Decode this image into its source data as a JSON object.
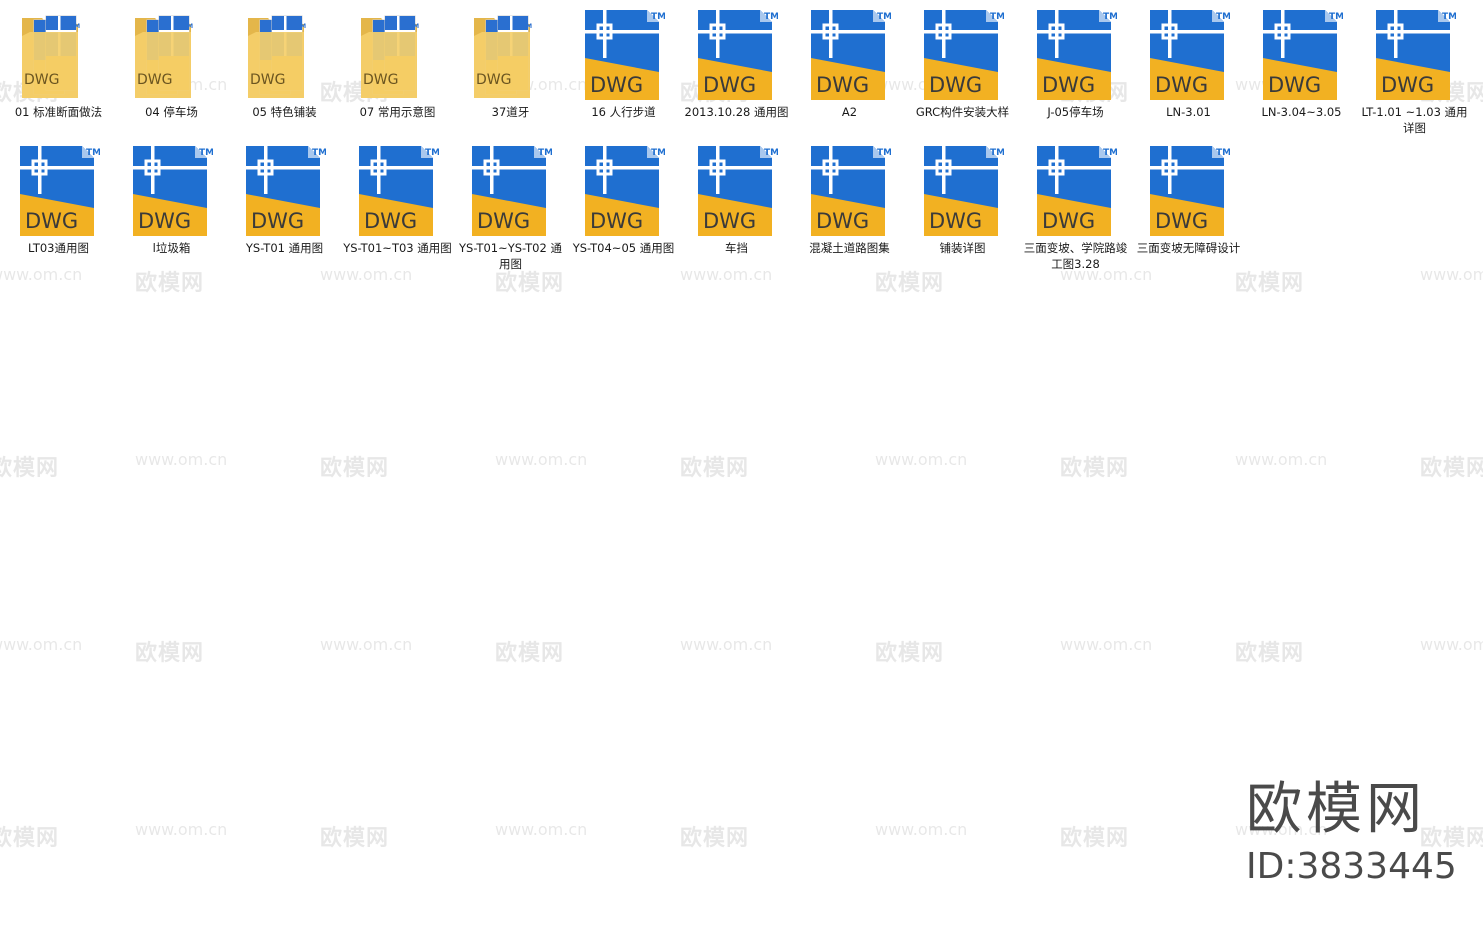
{
  "files": [
    {
      "kind": "folder",
      "label": "01 标准断面做法"
    },
    {
      "kind": "folder",
      "label": "04 停车场"
    },
    {
      "kind": "folder",
      "label": "05 特色铺装"
    },
    {
      "kind": "folder",
      "label": "07 常用示意图"
    },
    {
      "kind": "folder",
      "label": "37道牙"
    },
    {
      "kind": "dwg",
      "label": "16 人行步道"
    },
    {
      "kind": "dwg",
      "label": "2013.10.28 通用图"
    },
    {
      "kind": "dwg",
      "label": "A2"
    },
    {
      "kind": "dwg",
      "label": "GRC构件安装大样"
    },
    {
      "kind": "dwg",
      "label": "J-05停车场"
    },
    {
      "kind": "dwg",
      "label": "LN-3.01"
    },
    {
      "kind": "dwg",
      "label": "LN-3.04~3.05"
    },
    {
      "kind": "dwg",
      "label": "LT-1.01 ~1.03 通用详图"
    },
    {
      "kind": "dwg",
      "label": "LT03通用图"
    },
    {
      "kind": "dwg",
      "label": "l垃圾箱"
    },
    {
      "kind": "dwg",
      "label": "YS-T01 通用图"
    },
    {
      "kind": "dwg",
      "label": "YS-T01~T03 通用图"
    },
    {
      "kind": "dwg",
      "label": "YS-T01~YS-T02 通用图"
    },
    {
      "kind": "dwg",
      "label": "YS-T04~05 通用图"
    },
    {
      "kind": "dwg",
      "label": "车挡"
    },
    {
      "kind": "dwg",
      "label": "混凝土道路图集"
    },
    {
      "kind": "dwg",
      "label": "铺装详图"
    },
    {
      "kind": "dwg",
      "label": "三面变坡、学院路竣工图3.28"
    },
    {
      "kind": "dwg",
      "label": "三面变坡无障碍设计"
    }
  ],
  "icons": {
    "folder": "folder-icon",
    "dwg": "dwg-file-icon",
    "dwg_badge": "DWG",
    "tm": "TM",
    "folder_badge": "DWG"
  },
  "colors": {
    "dwg_blue": "#1f6fd0",
    "dwg_yellow": "#f2b122",
    "folder_yellow": "#f5cf6a"
  },
  "watermark": {
    "cn": "欧模网",
    "url": "www.om.cn"
  },
  "brand": {
    "name": "欧模网",
    "id": "ID:3833445"
  }
}
